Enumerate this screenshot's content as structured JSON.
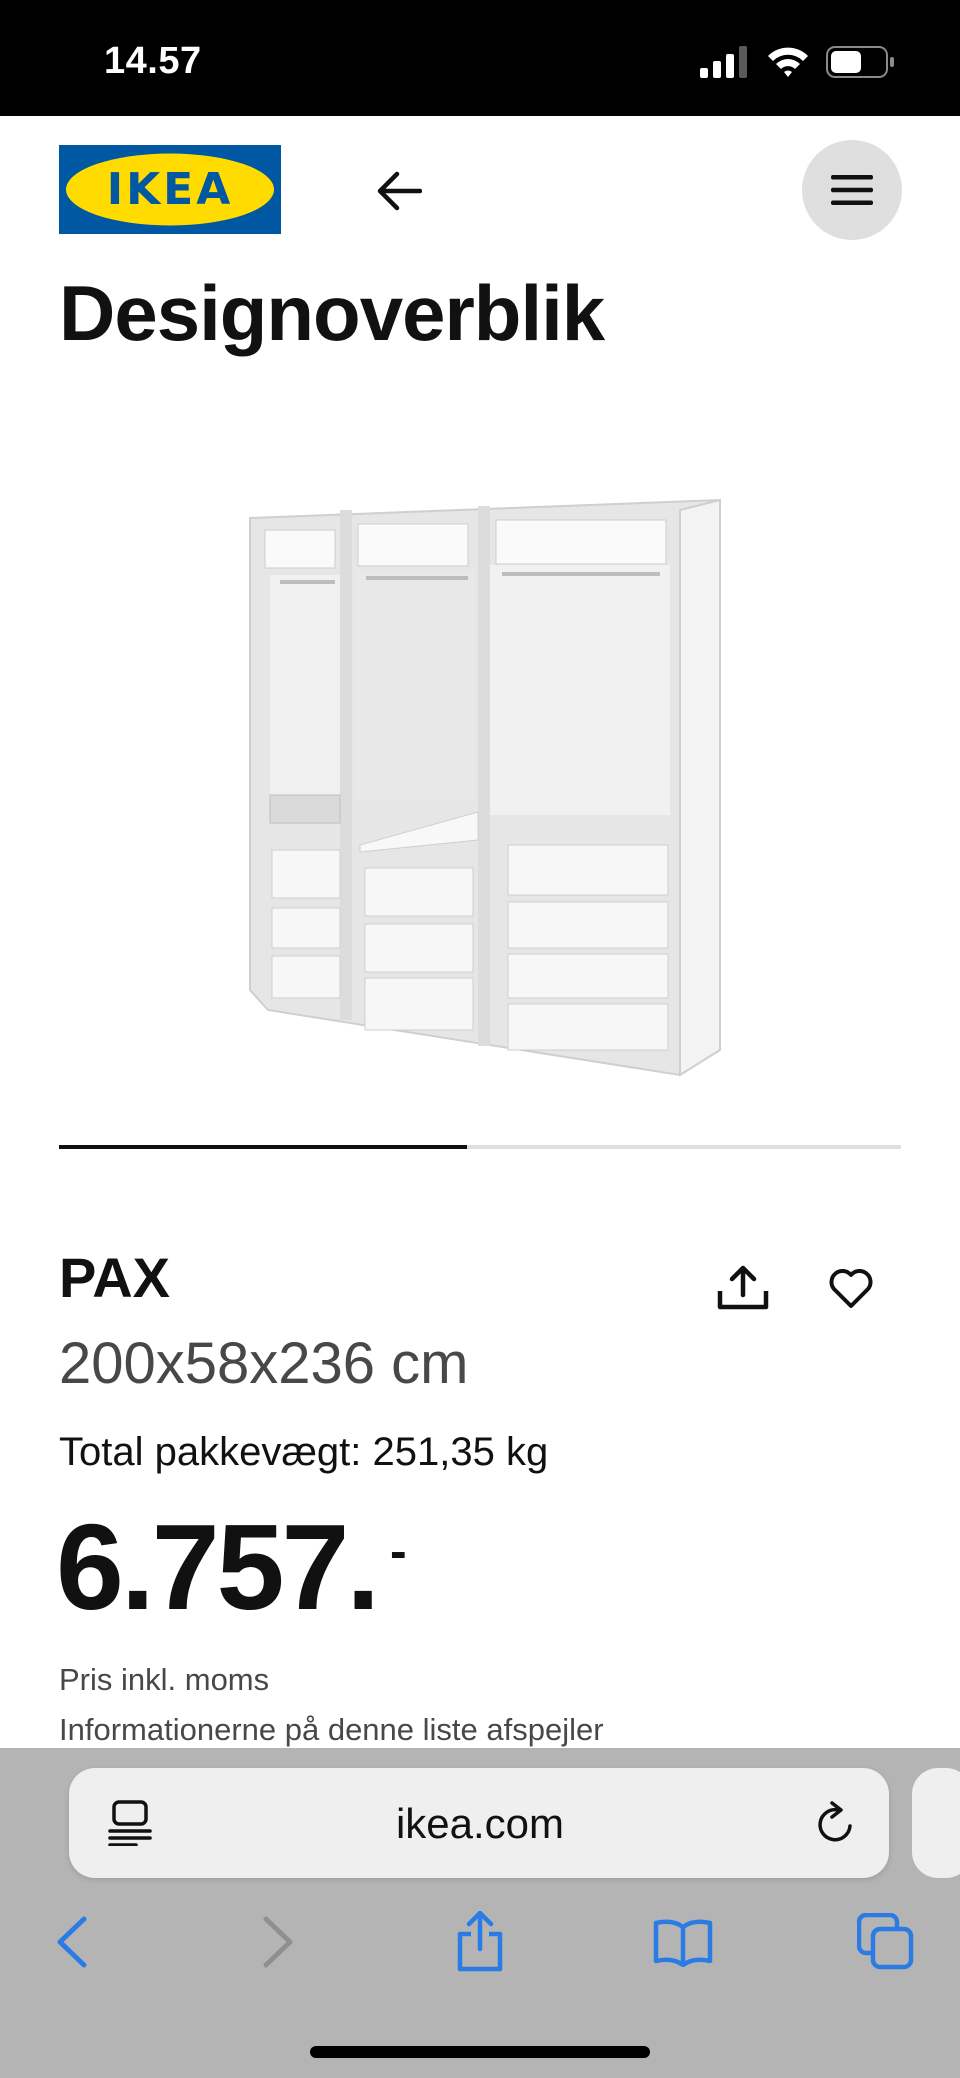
{
  "status_bar": {
    "time": "14.57"
  },
  "header": {
    "logo_text": "IKEA",
    "back_icon": "arrow-left-icon",
    "menu_icon": "hamburger-icon"
  },
  "page": {
    "title": "Designoverblik"
  },
  "carousel": {
    "progress": 0.485
  },
  "product": {
    "name": "PAX",
    "dimensions": "200x58x236 cm",
    "weight": "Total pakkevægt: 251,35 kg",
    "price": "6.757.",
    "price_suffix": "-",
    "price_note": "Pris inkl. moms",
    "info_note": "Informationerne på denne liste afspejler",
    "share_icon": "share-icon",
    "favorite_icon": "heart-icon"
  },
  "browser": {
    "url": "ikea.com",
    "accent_color": "#2a7be4",
    "icons": [
      "back-icon",
      "forward-icon",
      "share-icon",
      "bookmarks-icon",
      "tabs-icon"
    ]
  },
  "colors": {
    "ikea_blue": "#0058a3",
    "ikea_yellow": "#ffdb00"
  }
}
